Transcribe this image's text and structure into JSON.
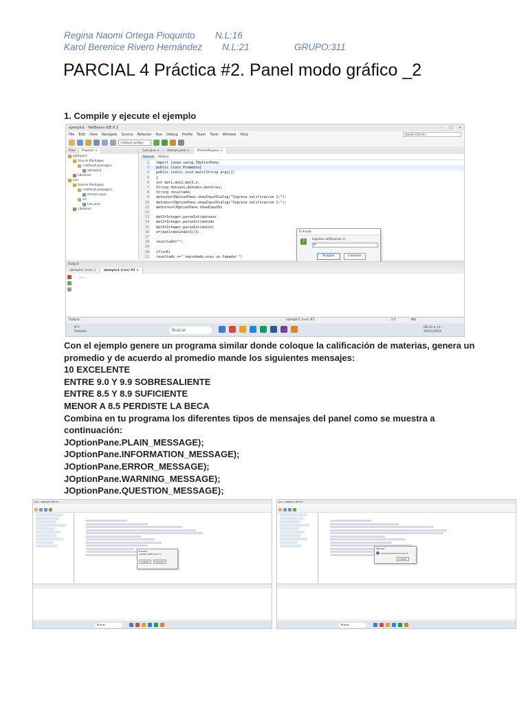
{
  "authors": {
    "line1_name": "Regina Naomi Ortega Pioquinto",
    "line1_nl": "N.L:16",
    "line2_name": "Karol Berenice Rivero Hernández",
    "line2_nl": "N.L:21",
    "group": "GRUPO:311"
  },
  "title": "PARCIAL 4 Práctica #2. Panel modo gráfico _2",
  "step1": "1. Compile y ejecute el ejemplo",
  "ide": {
    "window_title": "ejemplo1 - NetBeans IDE 8.2",
    "menu": [
      "File",
      "Edit",
      "View",
      "Navigate",
      "Source",
      "Refactor",
      "Run",
      "Debug",
      "Profile",
      "Team",
      "Tools",
      "Window",
      "Help"
    ],
    "search_placeholder": "Search (Ctrl+I)",
    "config": "<default config>",
    "panel_tabs": [
      "Files",
      "Projects ×"
    ],
    "tree": [
      "ejemplo1",
      "Source Packages",
      "<default package>",
      "ejemplo1",
      "Libraries",
      "Lee",
      "Source Packages",
      "<default package>",
      "sharlyn.java",
      "src",
      "Lee.java",
      "Libraries"
    ],
    "editor_tabs": [
      "Lee.java ×",
      "sharlyn.java ×",
      "Promedio.java ×"
    ],
    "editor_tools": [
      "Source",
      "History"
    ],
    "code_lines": [
      {
        "n": "2",
        "t": "import javax.swing.JOptionPane;"
      },
      {
        "n": "3",
        "t": "public class Promedio{"
      },
      {
        "n": "4",
        "t": "public static void main(String args[])"
      },
      {
        "n": "5",
        "t": "{"
      },
      {
        "n": "6",
        "t": "int dat1,dat2,dat3,x;"
      },
      {
        "n": "7",
        "t": "String datouno,datodos,datotres;"
      },
      {
        "n": "8",
        "t": "String resultado;"
      },
      {
        "n": "9",
        "t": "datouno=JOptionPane.showInputDialog(\"Ingresa calificacion 1:\");"
      },
      {
        "n": "10",
        "t": "datodos=JOptionPane.showInputDialog(\"Ingresa calificacion 2:\");"
      },
      {
        "n": "11",
        "t": "datotres=JOptionPane.showInputDi"
      },
      {
        "n": "12",
        "t": ""
      },
      {
        "n": "13",
        "t": "dat1=Integer.parseInt(datouno"
      },
      {
        "n": "14",
        "t": "dat2=Integer.parseInt(datodo"
      },
      {
        "n": "15",
        "t": "dat3=Integer.parseInt(datotr"
      },
      {
        "n": "16",
        "t": "x=(dat1+dat2+dat3)/3;"
      },
      {
        "n": "17",
        "t": ""
      },
      {
        "n": "18",
        "t": "resultado=\"\";"
      },
      {
        "n": "19",
        "t": ""
      },
      {
        "n": "20",
        "t": "if(x<6)"
      },
      {
        "n": "21",
        "t": "resultado +=\" reprobado,eres un fumador \";"
      }
    ],
    "dialog": {
      "title": "Entrada",
      "prompt": "Ingresa calificacion 3:",
      "value": "8",
      "ok": "Aceptar",
      "cancel": "Cancelar"
    },
    "output_label": "Output",
    "output_tabs": [
      "ejemplo1 (run) ×",
      "ejemplo1 (run) #2 ×"
    ],
    "output_text": "run:",
    "status_left": "Output",
    "status_right": "ejemplo1 (run) #2",
    "status_mode": "INS",
    "status_pos": "2:1",
    "weather_temp": "9°C",
    "weather_desc": "Soleado",
    "taskbar_search": "Buscar",
    "clock_time": "08:33 a. m.",
    "clock_date": "20/11/2024"
  },
  "body": {
    "paragraph": "Con el ejemplo genere un programa similar donde coloque la calificación de materias, genera un promedio y de acuerdo al promedio mande los siguientes mensajes:",
    "m1": "10 EXCELENTE",
    "m2": "ENTRE 9.0 Y 9.9 SOBRESALIENTE",
    "m3": "ENTRE 8.5 Y 8.9 SUFICIENTE",
    "m4": "MENOR A 8.5 PERDISTE LA BECA",
    "combine": "Combina en tu programa los diferentes tipos de mensajes del panel como se muestra a continuación:",
    "t1": "JOptionPane.PLAIN_MESSAGE);",
    "t2": "JOptionPane.INFORMATION_MESSAGE);",
    "t3": "JOptionPane.ERROR_MESSAGE);",
    "t4": "JOptionPane.WARNING_MESSAGE);",
    "t5": "JOptionPane.QUESTION_MESSAGE);"
  },
  "mini1": {
    "window_title": "java - NetBeans IDE 8.2",
    "dialog_title": "Entrada",
    "dialog_prompt": "Ingresa calificacion 3:",
    "ok": "Aceptar",
    "cancel": "Cancelar",
    "search": "Buscar"
  },
  "mini2": {
    "window_title": "java - NetBeans IDE 8.2",
    "dialog_title": "Mensaje",
    "ok": "Aceptar",
    "search": "Buscar"
  },
  "colors": {
    "author_text": "#5b7fc4",
    "dialog_question_icon": "#5a9a3a"
  }
}
